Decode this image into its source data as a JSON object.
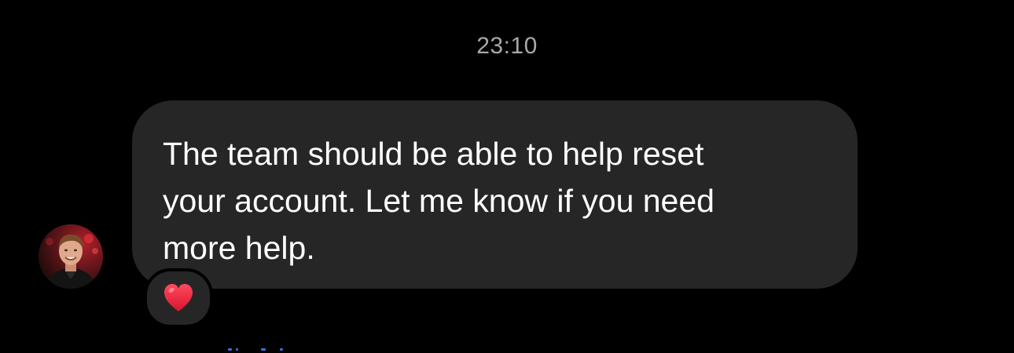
{
  "thread": {
    "timestamp": "23:10"
  },
  "message": {
    "text": "The team should be able to help reset\nyour account. Let me know if you need\nmore help.",
    "reaction": "❤️"
  },
  "sender": {
    "avatar_icon": "profile-photo"
  },
  "colors": {
    "background": "#000000",
    "bubble": "#262626",
    "timestamp": "#a8a8a8",
    "text": "#ffffff",
    "heart": "#e0203a"
  }
}
